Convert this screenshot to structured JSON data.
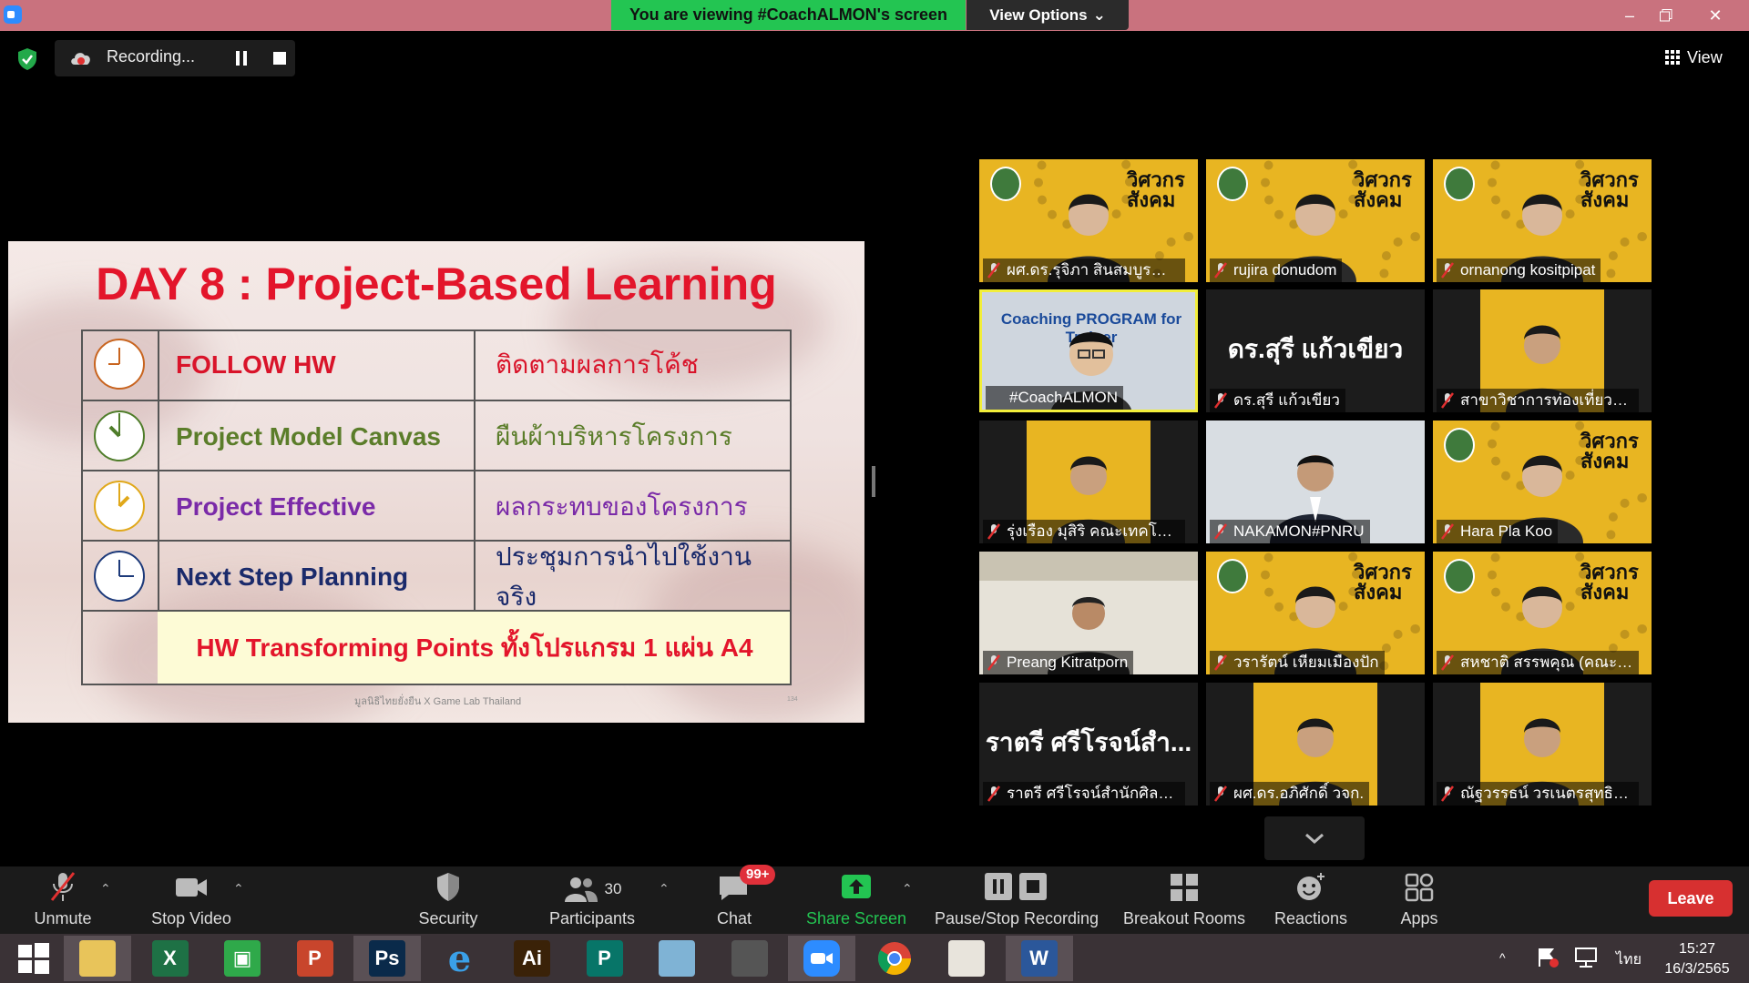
{
  "titlebar": {
    "viewing_banner": "You are viewing #CoachALMON's screen",
    "view_options": "View Options",
    "controls": [
      "minimize-icon",
      "restore-icon",
      "close-icon"
    ]
  },
  "recording": {
    "status": "Recording...",
    "view_label": "View"
  },
  "slide": {
    "title": "DAY 8 : Project-Based Learning",
    "rows": [
      {
        "label": "FOLLOW HW",
        "thai": "ติดตามผลการโค้ช",
        "color": "#d9142a",
        "clock_color": "#c8641f"
      },
      {
        "label": "Project Model Canvas",
        "thai": "ผืนผ้าบริหารโครงการ",
        "color": "#5b7d2a",
        "clock_color": "#4f7d2a"
      },
      {
        "label": "Project Effective",
        "thai": "ผลกระทบของโครงการ",
        "color": "#7a2aa8",
        "clock_color": "#e0a81a"
      },
      {
        "label": "Next Step Planning",
        "thai": "ประชุมการนำไปใช้งานจริง",
        "color": "#1a2a6b",
        "clock_color": "#1d3a7a"
      }
    ],
    "hw_line": "HW Transforming Points ทั้งโปรแกรม 1 แผ่น A4",
    "footer": "มูลนิธิไทยยั่งยืน X Game Lab Thailand",
    "page_number": "134"
  },
  "gallery": {
    "tiles": [
      {
        "name": "ผศ.ดร.รุจิภา สินสมบูรณ์ทอง,...",
        "type": "yellow"
      },
      {
        "name": "rujira donudom",
        "type": "yellow"
      },
      {
        "name": "ornanong kositpipat",
        "type": "yellow"
      },
      {
        "name": "#CoachALMON",
        "type": "active",
        "banner": "Coaching PROGRAM for Trainer"
      },
      {
        "name": "ดร.สุรี  แก้วเขียว",
        "type": "dark",
        "big": "ดร.สุรี  แก้วเขียว"
      },
      {
        "name": "สาขาวิชาการท่องเที่ยวและก...",
        "type": "darkyellow"
      },
      {
        "name": "รุ่งเรือง มุสิริ คณะเทคโนโลยีอุ...",
        "type": "darkyellow"
      },
      {
        "name": "NAKAMON#PNRU",
        "type": "office"
      },
      {
        "name": "Hara Pla Koo",
        "type": "yellow"
      },
      {
        "name": "Preang Kitratporn",
        "type": "office2"
      },
      {
        "name": "วรารัตน์ เหียมเมืองปัก",
        "type": "yellow"
      },
      {
        "name": "สหชาติ สรรพคุณ (คณะวิทย์...",
        "type": "yellow"
      },
      {
        "name": "ราตรี   ศรีโรจน์สำนักศิลปะแ...",
        "type": "dark",
        "big": "ราตรี   ศรีโรจน์สำ..."
      },
      {
        "name": "ผศ.ดร.อภิศักดิ์ วจก.",
        "type": "darkyellow"
      },
      {
        "name": "ณัฐวรรธน์ วรเนตรสุทธิกุล ค...",
        "type": "darkyellow"
      }
    ],
    "tile_tagline": "วิศวกร สังคม"
  },
  "toolbar": {
    "unmute": "Unmute",
    "stop_video": "Stop Video",
    "security": "Security",
    "participants": "Participants",
    "participants_count": "30",
    "chat": "Chat",
    "chat_badge": "99+",
    "share_screen": "Share Screen",
    "pause_stop_recording": "Pause/Stop Recording",
    "breakout_rooms": "Breakout Rooms",
    "reactions": "Reactions",
    "apps": "Apps",
    "leave": "Leave"
  },
  "taskbar": {
    "apps": [
      "start-icon",
      "file-explorer-icon",
      "excel-icon",
      "green-app-icon",
      "powerpoint-icon",
      "photoshop-icon",
      "internet-explorer-icon",
      "illustrator-icon",
      "publisher-icon",
      "feather-app-icon",
      "photoscape-icon",
      "zoom-icon",
      "chrome-icon",
      "camera-app-icon",
      "word-icon"
    ],
    "language": "ไทย",
    "time": "15:27",
    "date": "16/3/2565"
  },
  "colors": {
    "banner_green": "#23c552",
    "title_red": "#e3152b",
    "leave_red": "#d73030",
    "share_green": "#23c552",
    "tile_yellow": "#e8b522"
  }
}
